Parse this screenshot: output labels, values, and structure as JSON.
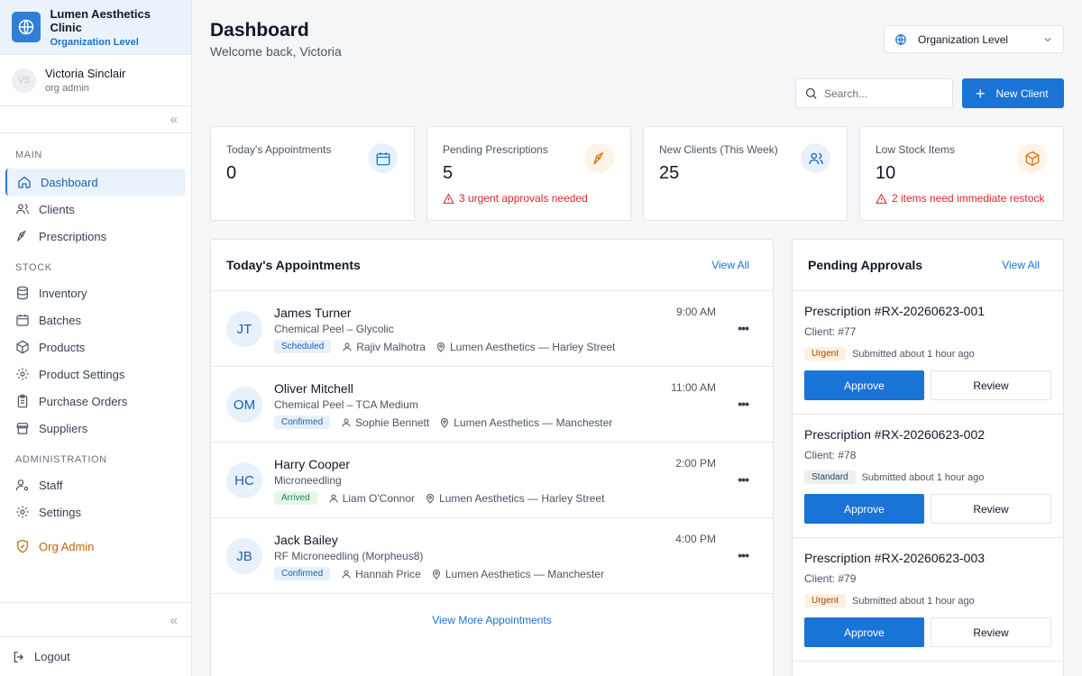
{
  "org": {
    "name": "Lumen Aesthetics Clinic",
    "level": "Organization Level"
  },
  "user": {
    "initials": "VS",
    "name": "Victoria Sinclair",
    "role": "org admin"
  },
  "sidebar": {
    "sections": {
      "main": "MAIN",
      "stock": "STOCK",
      "administration": "ADMINISTRATION"
    },
    "main": [
      {
        "label": "Dashboard",
        "icon": "home-icon"
      },
      {
        "label": "Clients",
        "icon": "users-icon"
      },
      {
        "label": "Prescriptions",
        "icon": "pen-nib-icon"
      }
    ],
    "stock": [
      {
        "label": "Inventory",
        "icon": "database-icon"
      },
      {
        "label": "Batches",
        "icon": "calendar-box-icon"
      },
      {
        "label": "Products",
        "icon": "package-icon"
      },
      {
        "label": "Product Settings",
        "icon": "gear-icon"
      },
      {
        "label": "Purchase Orders",
        "icon": "clipboard-icon"
      },
      {
        "label": "Suppliers",
        "icon": "store-icon"
      }
    ],
    "administration": [
      {
        "label": "Staff",
        "icon": "user-gear-icon"
      },
      {
        "label": "Settings",
        "icon": "gear-icon"
      }
    ],
    "org_admin": "Org Admin",
    "logout": "Logout"
  },
  "header": {
    "title": "Dashboard",
    "welcome": "Welcome back, Victoria",
    "level_select": "Organization Level"
  },
  "search": {
    "placeholder": "Search..."
  },
  "new_client": "New Client",
  "stats": [
    {
      "label": "Today's Appointments",
      "value": "0",
      "warn": ""
    },
    {
      "label": "Pending Prescriptions",
      "value": "5",
      "warn": "3 urgent approvals needed"
    },
    {
      "label": "New Clients (This Week)",
      "value": "25",
      "warn": ""
    },
    {
      "label": "Low Stock Items",
      "value": "10",
      "warn": "2 items need immediate restock"
    }
  ],
  "appointments": {
    "title": "Today's Appointments",
    "view_all": "View All",
    "view_more": "View More Appointments",
    "items": [
      {
        "initials": "JT",
        "name": "James Turner",
        "treatment": "Chemical Peel – Glycolic",
        "status": "Scheduled",
        "staff": "Rajiv Malhotra",
        "location": "Lumen Aesthetics — Harley Street",
        "time": "9:00 AM"
      },
      {
        "initials": "OM",
        "name": "Oliver Mitchell",
        "treatment": "Chemical Peel – TCA Medium",
        "status": "Confirmed",
        "staff": "Sophie Bennett",
        "location": "Lumen Aesthetics — Manchester",
        "time": "11:00 AM"
      },
      {
        "initials": "HC",
        "name": "Harry Cooper",
        "treatment": "Microneedling",
        "status": "Arrived",
        "staff": "Liam O'Connor",
        "location": "Lumen Aesthetics — Harley Street",
        "time": "2:00 PM"
      },
      {
        "initials": "JB",
        "name": "Jack Bailey",
        "treatment": "RF Microneedling (Morpheus8)",
        "status": "Confirmed",
        "staff": "Hannah Price",
        "location": "Lumen Aesthetics — Manchester",
        "time": "4:00 PM"
      }
    ]
  },
  "approvals": {
    "title": "Pending Approvals",
    "view_all": "View All",
    "items": [
      {
        "title": "Prescription #RX-20260623-001",
        "client": "Client: #77",
        "priority": "Urgent",
        "submitted": "Submitted about 1 hour ago",
        "approve": "Approve",
        "review": "Review"
      },
      {
        "title": "Prescription #RX-20260623-002",
        "client": "Client: #78",
        "priority": "Standard",
        "submitted": "Submitted about 1 hour ago",
        "approve": "Approve",
        "review": "Review"
      },
      {
        "title": "Prescription #RX-20260623-003",
        "client": "Client: #79",
        "priority": "Urgent",
        "submitted": "Submitted about 1 hour ago",
        "approve": "Approve",
        "review": "Review"
      }
    ]
  },
  "colors": {
    "accent": "#1a73d6",
    "danger": "#dc2626",
    "org_admin": "#c2640a"
  }
}
